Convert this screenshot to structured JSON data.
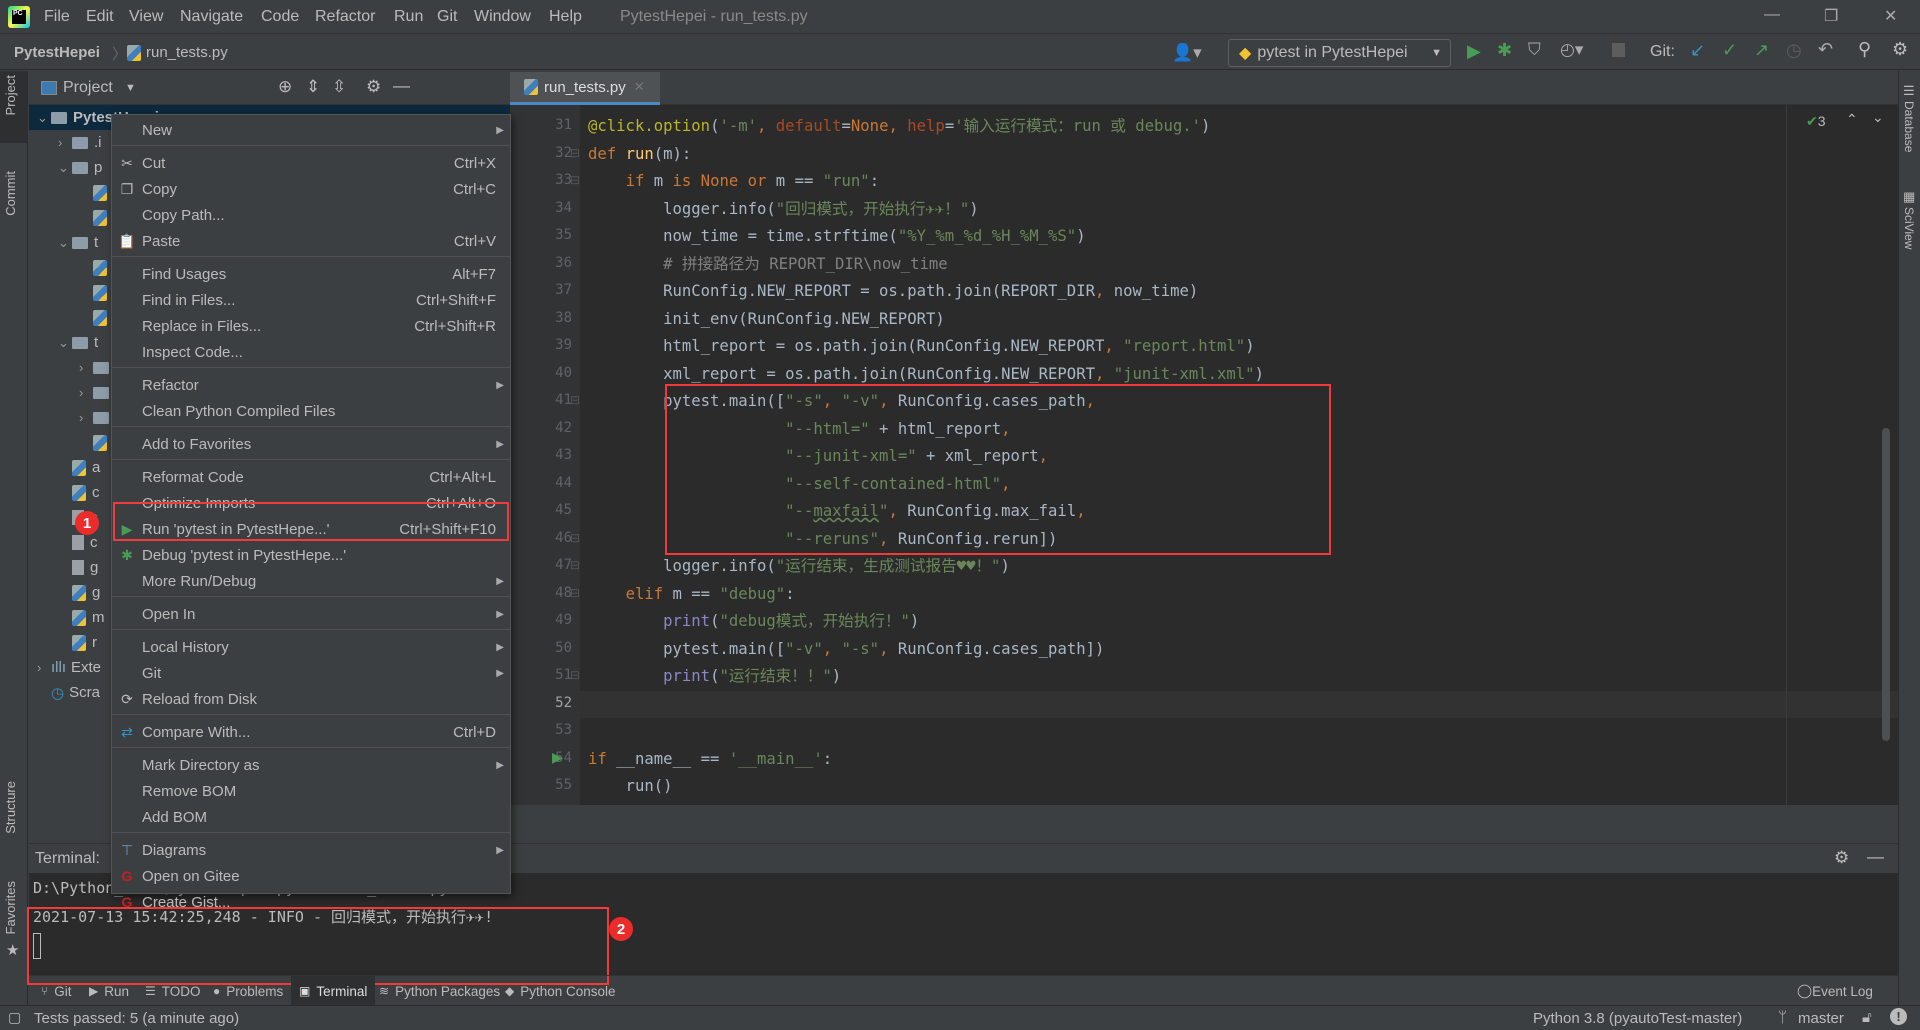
{
  "app": {
    "menu": [
      "File",
      "Edit",
      "View",
      "Navigate",
      "Code",
      "Refactor",
      "Run",
      "Git",
      "Window",
      "Help"
    ],
    "window_title": "PytestHepei - run_tests.py"
  },
  "nav": {
    "project": "PytestHepei",
    "file": "run_tests.py"
  },
  "toolbar": {
    "run_config": "pytest in PytestHepei",
    "git_label": "Git:",
    "icons": [
      "user-icon",
      "run-icon",
      "debug-icon",
      "coverage-icon",
      "profile-icon",
      "stop-icon",
      "git-update-icon",
      "git-commit-icon",
      "git-push-icon",
      "history-icon",
      "rollback-icon",
      "search-icon",
      "settings-icon"
    ]
  },
  "left_strip": {
    "project": "Project",
    "commit": "Commit",
    "structure": "Structure",
    "favorites": "Favorites"
  },
  "right_strip": {
    "database": "Database",
    "sciview": "SciView"
  },
  "project_panel": {
    "title": "Project",
    "tree": [
      {
        "label": "PytestHepei",
        "kind": "folder",
        "depth": 0,
        "open": true,
        "root": true
      },
      {
        "label": ".i",
        "kind": "folder",
        "depth": 1,
        "open": false
      },
      {
        "label": "p",
        "kind": "folder",
        "depth": 1,
        "open": true
      },
      {
        "label": "",
        "kind": "py",
        "depth": 2
      },
      {
        "label": "",
        "kind": "py",
        "depth": 2
      },
      {
        "label": "t",
        "kind": "folder",
        "depth": 1,
        "open": true
      },
      {
        "label": "",
        "kind": "py",
        "depth": 2
      },
      {
        "label": "",
        "kind": "py",
        "depth": 2
      },
      {
        "label": "",
        "kind": "py",
        "depth": 2
      },
      {
        "label": "t",
        "kind": "folder",
        "depth": 1,
        "open": true
      },
      {
        "label": "",
        "kind": "folder",
        "depth": 2,
        "open": false
      },
      {
        "label": "",
        "kind": "folder",
        "depth": 2,
        "open": false
      },
      {
        "label": "",
        "kind": "folder",
        "depth": 2,
        "open": false
      },
      {
        "label": "",
        "kind": "py",
        "depth": 2
      },
      {
        "label": "a",
        "kind": "py",
        "depth": 1
      },
      {
        "label": "c",
        "kind": "py",
        "depth": 1
      },
      {
        "label": "c",
        "kind": "txt",
        "depth": 1
      },
      {
        "label": "c",
        "kind": "txt",
        "depth": 1
      },
      {
        "label": "g",
        "kind": "txt",
        "depth": 1
      },
      {
        "label": "g",
        "kind": "py",
        "depth": 1
      },
      {
        "label": "m",
        "kind": "py",
        "depth": 1
      },
      {
        "label": "r",
        "kind": "py",
        "depth": 1
      },
      {
        "label": "Exte",
        "kind": "lib",
        "depth": 0,
        "open": false
      },
      {
        "label": "Scra",
        "kind": "scratch",
        "depth": 0
      }
    ]
  },
  "editor": {
    "tab": "run_tests.py",
    "inspections": "3",
    "current_line": 52,
    "lines": [
      {
        "n": 31,
        "t": [
          [
            "dec",
            "@click.option"
          ],
          [
            "d",
            "("
          ],
          [
            "s",
            "'-m'"
          ],
          [
            "kw",
            ", "
          ],
          [
            "ka",
            "default"
          ],
          [
            "d",
            "="
          ],
          [
            "kw",
            "None"
          ],
          [
            "kw",
            ", "
          ],
          [
            "ka",
            "help"
          ],
          [
            "d",
            "="
          ],
          [
            "s",
            "'输入运行模式：run 或 debug.'"
          ],
          [
            "d",
            ")"
          ]
        ]
      },
      {
        "n": 32,
        "t": [
          [
            "kw",
            "def "
          ],
          [
            "fn",
            "run"
          ],
          [
            "d",
            "(m):"
          ]
        ]
      },
      {
        "n": 33,
        "t": [
          [
            "d",
            "    "
          ],
          [
            "kw",
            "if "
          ],
          [
            "d",
            "m "
          ],
          [
            "kw",
            "is None or "
          ],
          [
            "d",
            "m == "
          ],
          [
            "s",
            "\"run\""
          ],
          [
            "d",
            ":"
          ]
        ]
      },
      {
        "n": 34,
        "t": [
          [
            "d",
            "        logger.info("
          ],
          [
            "s",
            "\"回归模式，开始执行✈✈！\""
          ],
          [
            "d",
            ")"
          ]
        ]
      },
      {
        "n": 35,
        "t": [
          [
            "d",
            "        now_time = time.strftime("
          ],
          [
            "s",
            "\"%Y_%m_%d_%H_%M_%S\""
          ],
          [
            "d",
            ")"
          ]
        ]
      },
      {
        "n": 36,
        "t": [
          [
            "d",
            "        "
          ],
          [
            "c",
            "# 拼接路径为 REPORT_DIR\\now_time"
          ]
        ]
      },
      {
        "n": 37,
        "t": [
          [
            "d",
            "        RunConfig.NEW_REPORT = os.path.join(REPORT_DIR"
          ],
          [
            "kw",
            ", "
          ],
          [
            "d",
            "now_time)"
          ]
        ]
      },
      {
        "n": 38,
        "t": [
          [
            "d",
            "        init_env(RunConfig.NEW_REPORT)"
          ]
        ]
      },
      {
        "n": 39,
        "t": [
          [
            "d",
            "        html_report = os.path.join(RunConfig.NEW_REPORT"
          ],
          [
            "kw",
            ", "
          ],
          [
            "s",
            "\"report.html\""
          ],
          [
            "d",
            ")"
          ]
        ]
      },
      {
        "n": 40,
        "t": [
          [
            "d",
            "        xml_report = os.path.join(RunConfig.NEW_REPORT"
          ],
          [
            "kw",
            ", "
          ],
          [
            "s",
            "\"junit-xml.xml\""
          ],
          [
            "d",
            ")"
          ]
        ]
      },
      {
        "n": 41,
        "t": [
          [
            "d",
            "        pytest.main(["
          ],
          [
            "s",
            "\"-s\""
          ],
          [
            "kw",
            ", "
          ],
          [
            "s",
            "\"-v\""
          ],
          [
            "kw",
            ", "
          ],
          [
            "d",
            "RunConfig.cases_path"
          ],
          [
            "kw",
            ","
          ]
        ]
      },
      {
        "n": 42,
        "t": [
          [
            "d",
            "                     "
          ],
          [
            "s",
            "\"--html=\""
          ],
          [
            "d",
            " + html_report"
          ],
          [
            "kw",
            ","
          ]
        ]
      },
      {
        "n": 43,
        "t": [
          [
            "d",
            "                     "
          ],
          [
            "s",
            "\"--junit-xml=\""
          ],
          [
            "d",
            " + xml_report"
          ],
          [
            "kw",
            ","
          ]
        ]
      },
      {
        "n": 44,
        "t": [
          [
            "d",
            "                     "
          ],
          [
            "s",
            "\"--self-contained-html\""
          ],
          [
            "kw",
            ","
          ]
        ]
      },
      {
        "n": 45,
        "t": [
          [
            "d",
            "                     "
          ],
          [
            "s",
            "\"--"
          ],
          [
            "s ul",
            "maxfail"
          ],
          [
            "s",
            "\""
          ],
          [
            "kw",
            ", "
          ],
          [
            "d",
            "RunConfig.max_fail"
          ],
          [
            "kw",
            ","
          ]
        ]
      },
      {
        "n": 46,
        "t": [
          [
            "d",
            "                     "
          ],
          [
            "s",
            "\"--reruns\""
          ],
          [
            "kw",
            ", "
          ],
          [
            "d",
            "RunConfig.rerun])"
          ]
        ]
      },
      {
        "n": 47,
        "t": [
          [
            "d",
            "        logger.info("
          ],
          [
            "s",
            "\"运行结束，生成测试报告♥♥！\""
          ],
          [
            "d",
            ")"
          ]
        ]
      },
      {
        "n": 48,
        "t": [
          [
            "d",
            "    "
          ],
          [
            "kw",
            "elif "
          ],
          [
            "d",
            "m == "
          ],
          [
            "s",
            "\"debug\""
          ],
          [
            "d",
            ":"
          ]
        ]
      },
      {
        "n": 49,
        "t": [
          [
            "d",
            "        "
          ],
          [
            "b",
            "print"
          ],
          [
            "d",
            "("
          ],
          [
            "s",
            "\"debug模式，开始执行！\""
          ],
          [
            "d",
            ")"
          ]
        ]
      },
      {
        "n": 50,
        "t": [
          [
            "d",
            "        pytest.main(["
          ],
          [
            "s",
            "\"-v\""
          ],
          [
            "kw",
            ", "
          ],
          [
            "s",
            "\"-s\""
          ],
          [
            "kw",
            ", "
          ],
          [
            "d",
            "RunConfig.cases_path])"
          ]
        ]
      },
      {
        "n": 51,
        "t": [
          [
            "d",
            "        "
          ],
          [
            "b",
            "print"
          ],
          [
            "d",
            "("
          ],
          [
            "s",
            "\"运行结束！！\""
          ],
          [
            "d",
            ")"
          ]
        ]
      },
      {
        "n": 52,
        "t": []
      },
      {
        "n": 53,
        "t": []
      },
      {
        "n": 54,
        "t": [
          [
            "kw",
            "if "
          ],
          [
            "d",
            "__name__ == "
          ],
          [
            "s",
            "'__main__'"
          ],
          [
            "d",
            ":"
          ]
        ]
      },
      {
        "n": 55,
        "t": [
          [
            "d",
            "    run()"
          ]
        ]
      }
    ]
  },
  "context_menu": {
    "items": [
      {
        "label": "New",
        "sub": true,
        "sep": true
      },
      {
        "label": "Cut",
        "shortcut": "Ctrl+X",
        "icon": "✂",
        "icon_name": "scissors-icon"
      },
      {
        "label": "Copy",
        "shortcut": "Ctrl+C",
        "icon": "❐",
        "icon_name": "copy-icon"
      },
      {
        "label": "Copy Path..."
      },
      {
        "label": "Paste",
        "shortcut": "Ctrl+V",
        "icon": "📋",
        "icon_name": "clipboard-icon",
        "sep": true
      },
      {
        "label": "Find Usages",
        "shortcut": "Alt+F7"
      },
      {
        "label": "Find in Files...",
        "shortcut": "Ctrl+Shift+F"
      },
      {
        "label": "Replace in Files...",
        "shortcut": "Ctrl+Shift+R"
      },
      {
        "label": "Inspect Code...",
        "sep": true
      },
      {
        "label": "Refactor",
        "sub": true
      },
      {
        "label": "Clean Python Compiled Files",
        "sep": true
      },
      {
        "label": "Add to Favorites",
        "sub": true,
        "sep": true
      },
      {
        "label": "Reformat Code",
        "shortcut": "Ctrl+Alt+L"
      },
      {
        "label": "Optimize Imports",
        "shortcut": "Ctrl+Alt+O"
      },
      {
        "label": "Run 'pytest in PytestHepe...'",
        "shortcut": "Ctrl+Shift+F10",
        "icon": "▶",
        "icon_name": "run-icon",
        "icon_color": "#499c54"
      },
      {
        "label": "Debug 'pytest in PytestHepe...'",
        "icon": "✱",
        "icon_name": "debug-icon",
        "icon_color": "#499c54"
      },
      {
        "label": "More Run/Debug",
        "sub": true,
        "sep": true
      },
      {
        "label": "Open In",
        "sub": true,
        "sep": true
      },
      {
        "label": "Local History",
        "sub": true
      },
      {
        "label": "Git",
        "sub": true
      },
      {
        "label": "Reload from Disk",
        "icon": "⟳",
        "icon_name": "reload-icon",
        "sep": true
      },
      {
        "label": "Compare With...",
        "shortcut": "Ctrl+D",
        "icon": "⇄",
        "icon_name": "compare-icon",
        "icon_color": "#3592c4",
        "sep": true
      },
      {
        "label": "Mark Directory as",
        "sub": true
      },
      {
        "label": "Remove BOM"
      },
      {
        "label": "Add BOM",
        "sep": true
      },
      {
        "label": "Diagrams",
        "sub": true,
        "icon": "⊤",
        "icon_name": "diagram-icon",
        "icon_color": "#6897bb"
      },
      {
        "label": "Open on Gitee",
        "icon": "G",
        "icon_name": "gitee-icon",
        "icon_color": "#c71d23"
      },
      {
        "label": "Create Gist...",
        "icon": "G",
        "icon_name": "gitee-icon",
        "icon_color": "#c71d23"
      }
    ]
  },
  "annotations": {
    "badge1": "1",
    "badge2": "2",
    "highlight_color": "#f23a3a"
  },
  "terminal": {
    "title": "Terminal:",
    "lines": [
      "D:\\Python_case\\PytestHepei>python run_tests.py",
      "2021-07-13 15:42:25,248 - INFO - 回归模式，开始执行✈✈!"
    ]
  },
  "bottom_tabs": [
    {
      "label": "Git",
      "icon": "git-icon"
    },
    {
      "label": "Run",
      "icon": "run-icon"
    },
    {
      "label": "TODO",
      "icon": "list-icon"
    },
    {
      "label": "Problems",
      "icon": "warning-icon"
    },
    {
      "label": "Terminal",
      "icon": "terminal-icon",
      "selected": true
    },
    {
      "label": "Python Packages",
      "icon": "layers-icon"
    },
    {
      "label": "Python Console",
      "icon": "python-icon"
    }
  ],
  "event_log": "Event Log",
  "status": {
    "tests": "Tests passed: 5 (a minute ago)",
    "interpreter": "Python 3.8 (pyautoTest-master)",
    "branch": "master"
  }
}
